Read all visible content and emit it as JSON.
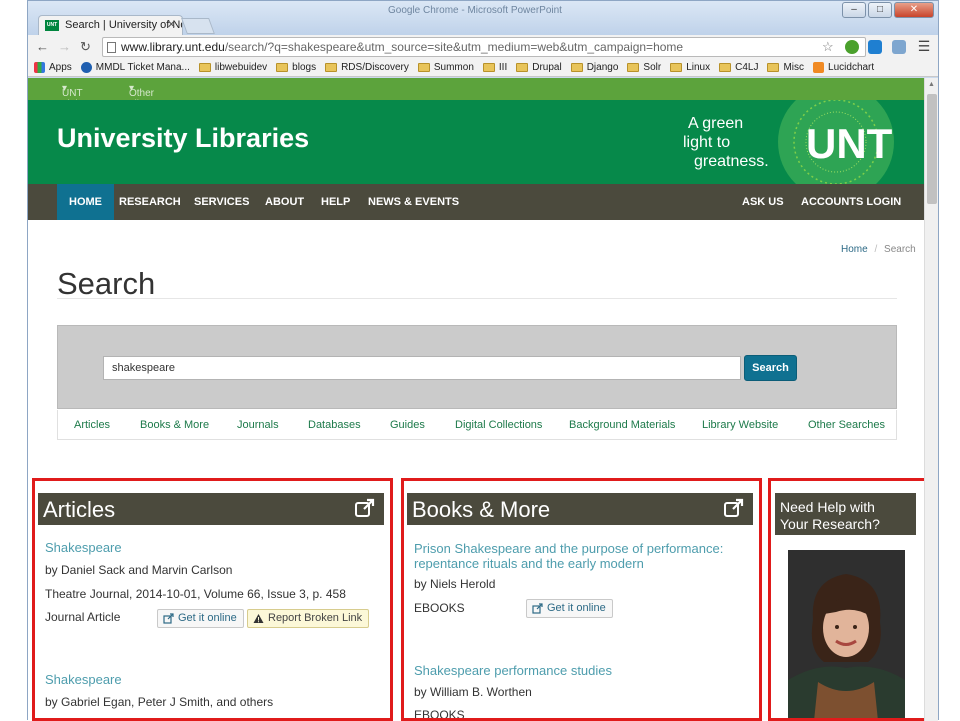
{
  "browser": {
    "tab_title": "Search | University of North",
    "window_title": "Google Chrome - Microsoft PowerPoint",
    "url_prefix": "www.library.unt.edu",
    "url_rest": "/search/?q=shakespeare&utm_source=site&utm_medium=web&utm_campaign=home",
    "bookmarks": [
      "Apps",
      "MMDL Ticket Mana...",
      "libwebuidev",
      "blogs",
      "RDS/Discovery",
      "Summon",
      "III",
      "Drupal",
      "Django",
      "Solr",
      "Linux",
      "C4LJ",
      "Misc",
      "Lucidchart"
    ]
  },
  "site": {
    "top_links": [
      "UNT Links",
      "Other Library Sites"
    ],
    "title": "University Libraries",
    "slogan": [
      "A green",
      "light to",
      "greatness."
    ],
    "logo_text": "UNT",
    "nav": [
      "HOME",
      "RESEARCH",
      "SERVICES",
      "ABOUT",
      "HELP",
      "NEWS & EVENTS"
    ],
    "nav_right": [
      "ASK US",
      "ACCOUNTS LOGIN"
    ],
    "breadcrumb": {
      "home": "Home",
      "separator": "/",
      "current": "Search"
    },
    "page_title": "Search"
  },
  "search": {
    "query": "shakespeare",
    "button": "Search",
    "tabs": [
      "Articles",
      "Books & More",
      "Journals",
      "Databases",
      "Guides",
      "Digital Collections",
      "Background Materials",
      "Library Website",
      "Other Searches"
    ]
  },
  "articles": {
    "heading": "Articles",
    "results": [
      {
        "title": "Shakespeare",
        "authors": "by Daniel Sack and Marvin Carlson",
        "source": "Theatre Journal, 2014-10-01, Volume 66, Issue 3, p. 458",
        "type": "Journal Article",
        "action": "Get it online",
        "report": "Report Broken Link"
      },
      {
        "title": "Shakespeare",
        "authors": "by Gabriel Egan, Peter J Smith, and others"
      }
    ]
  },
  "books": {
    "heading": "Books & More",
    "results": [
      {
        "title_line1": "Prison Shakespeare and the purpose of performance:",
        "title_line2": "repentance rituals and the early modern",
        "author": "by Niels Herold",
        "format": "EBOOKS",
        "action": "Get it online"
      },
      {
        "title": "Shakespeare performance studies",
        "author": "by William B. Worthen",
        "format": "EBOOKS"
      }
    ]
  },
  "help": {
    "heading_line1": "Need Help with",
    "heading_line2": "Your Research?"
  },
  "colors": {
    "unt_green": "#06894a",
    "nav_dark": "#4b4a3d",
    "active_blue": "#0f7191",
    "highlight_red": "#e01b1b"
  }
}
